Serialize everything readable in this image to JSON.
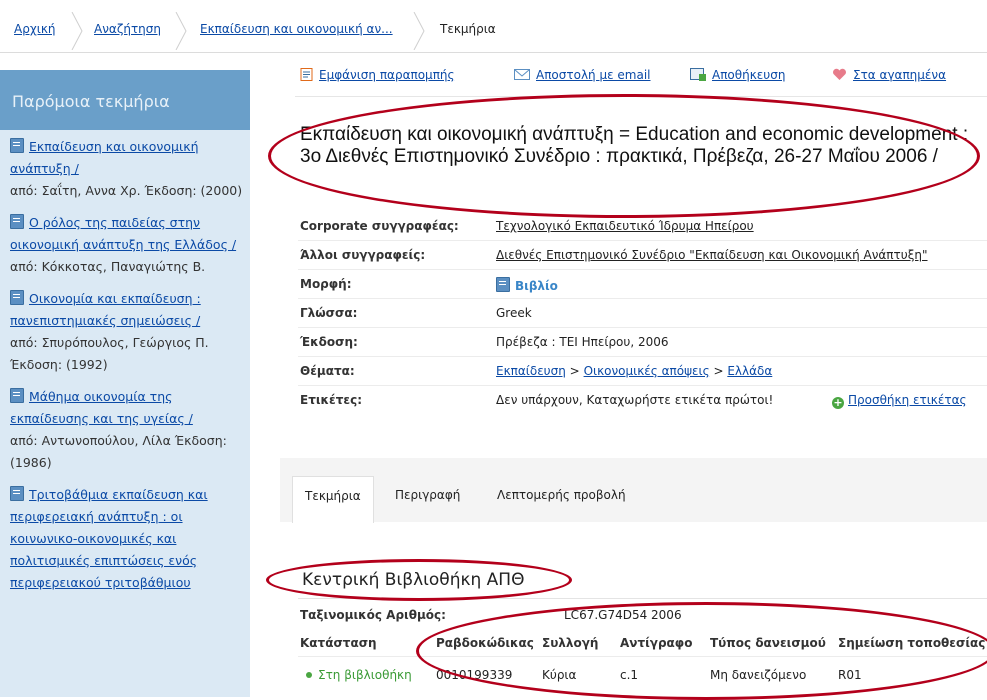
{
  "breadcrumb": [
    "Αρχική",
    "Αναζήτηση",
    "Εκπαίδευση και οικονομική αν...",
    "Τεκμήρια"
  ],
  "sidebar": {
    "title": "Παρόμοια τεκμήρια",
    "items": [
      {
        "title": "Εκπαίδευση και οικονομική ανάπτυξη /",
        "author": "από: Σαΐτη, Αννα Χρ. Έκδοση: (2000)"
      },
      {
        "title": "Ο ρόλος της παιδείας στην οικονομική ανάπτυξη της Ελλάδος /",
        "author": "από: Κόκκοτας, Παναγιώτης Β."
      },
      {
        "title": "Οικονομία και εκπαίδευση : πανεπιστημιακές σημειώσεις /",
        "author": "από: Σπυρόπουλος, Γεώργιος Π. Έκδοση: (1992)"
      },
      {
        "title": "Μάθημα οικονομία της εκπαίδευσης και της υγείας /",
        "author": "από: Αντωνοπούλου, Λίλα Έκδοση: (1986)"
      },
      {
        "title": "Τριτοβάθμια εκπαίδευση και περιφερειακή ανάπτυξη : οι κοινωνικο-οικονομικές και πολιτισμικές επιπτώσεις ενός περιφερειακού τριτοβάθμιου",
        "author": ""
      }
    ]
  },
  "toolbar": {
    "cite": "Εμφάνιση παραπομπής",
    "email": "Αποστολή με email",
    "save": "Αποθήκευση",
    "favorites": "Στα αγαπημένα"
  },
  "record": {
    "title": "Εκπαίδευση και οικονομική ανάπτυξη = Education and economic development : 3ο Διεθνές Επιστημονικό Συνέδριο : πρακτικά, Πρέβεζα, 26-27 Μαΐου 2006 /",
    "rows": {
      "corporate": {
        "label": "Corporate συγγραφέας:",
        "value": "Τεχνολογικό Εκπαιδευτικό Ίδρυμα Ηπείρου"
      },
      "others": {
        "label": "Άλλοι συγγραφείς:",
        "value": "Διεθνές Επιστημονικό Συνέδριο \"Εκπαίδευση και Οικονομική Ανάπτυξη\""
      },
      "format": {
        "label": "Μορφή:",
        "value": "Βιβλίο"
      },
      "language": {
        "label": "Γλώσσα:",
        "value": "Greek"
      },
      "edition": {
        "label": "Έκδοση:",
        "value": "Πρέβεζα : ΤΕΙ Ηπείρου, 2006"
      },
      "subjects": {
        "label": "Θέματα:",
        "s1": "Εκπαίδευση",
        "sep": ">",
        "s2": "Οικονομικές απόψεις",
        "s3": "Ελλάδα"
      },
      "tags": {
        "label": "Ετικέτες:",
        "value": "Δεν υπάρχουν, Καταχωρήστε ετικέτα πρώτοι!",
        "add": "Προσθήκη ετικέτας"
      }
    }
  },
  "tabs": [
    "Τεκμήρια",
    "Περιγραφή",
    "Λεπτομερής προβολή"
  ],
  "holdings": {
    "library": "Κεντρική Βιβλιοθήκη ΑΠΘ",
    "call_label": "Ταξινομικός Αριθμός:",
    "call_number": "LC67.G74D54 2006",
    "headers": [
      "Κατάσταση",
      "Ραβδοκώδικας",
      "Συλλογή",
      "Αντίγραφο",
      "Τύπος δανεισμού",
      "Σημείωση τοποθεσίας"
    ],
    "row": [
      "Στη βιβλιοθήκη",
      "0010199339",
      "Κύρια",
      "c.1",
      "Μη δανειζόμενο",
      "R01"
    ]
  }
}
